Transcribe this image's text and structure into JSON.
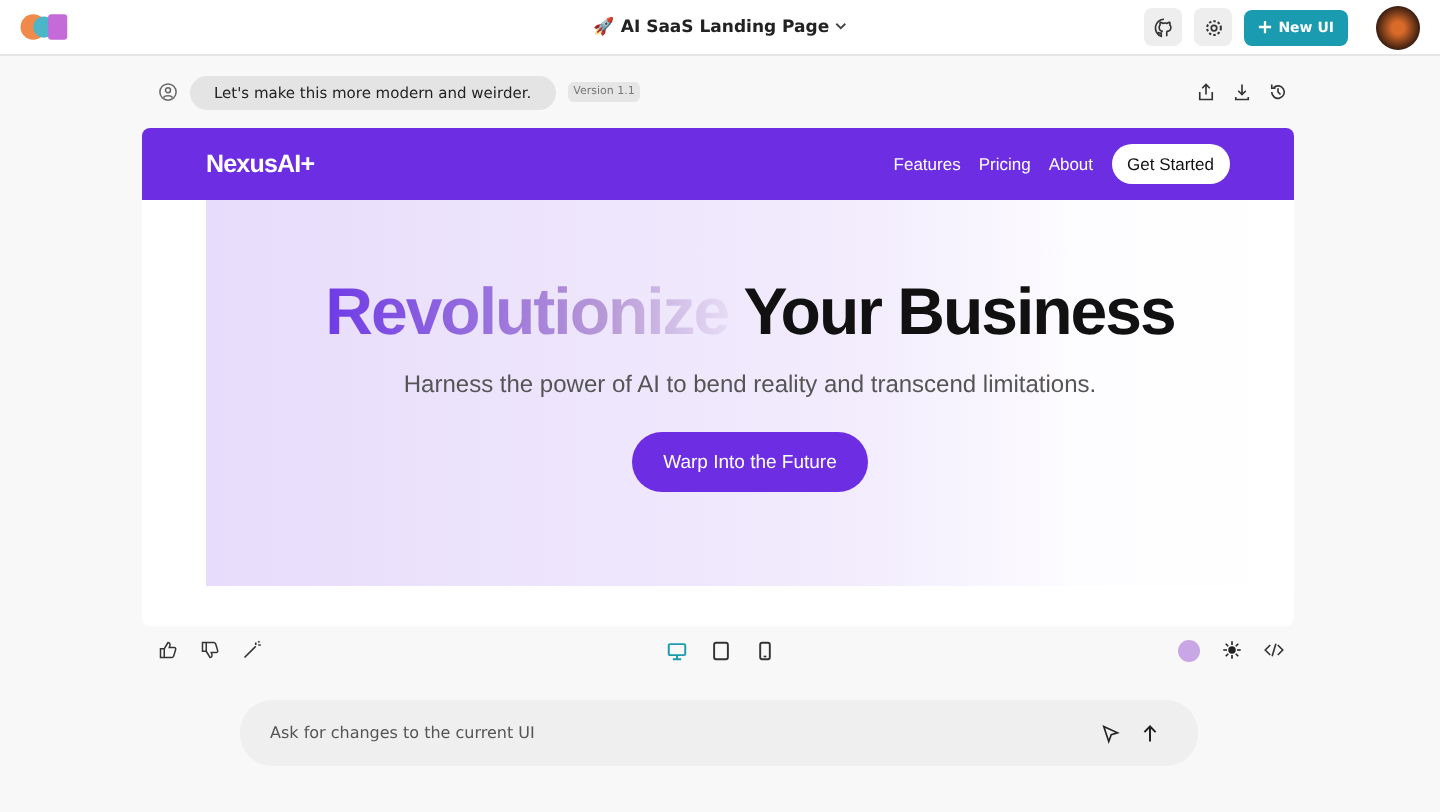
{
  "header": {
    "title": "🚀 AI SaaS Landing Page",
    "new_button": "New UI"
  },
  "prompt": {
    "message": "Let's make this more modern and weirder.",
    "version": "Version 1.1"
  },
  "preview": {
    "brand": "NexusAI+",
    "nav": [
      "Features",
      "Pricing",
      "About"
    ],
    "cta": "Get Started",
    "headline_gradient": "Revolutionize",
    "headline_rest": "Your Business",
    "subtitle": "Harness the power of AI to bend reality and transcend limitations.",
    "hero_button": "Warp Into the Future"
  },
  "devices": [
    {
      "kind": "desktop",
      "selected": true
    },
    {
      "kind": "tablet",
      "selected": false
    },
    {
      "kind": "phone",
      "selected": false
    }
  ],
  "input": {
    "placeholder": "Ask for changes to the current UI"
  }
}
